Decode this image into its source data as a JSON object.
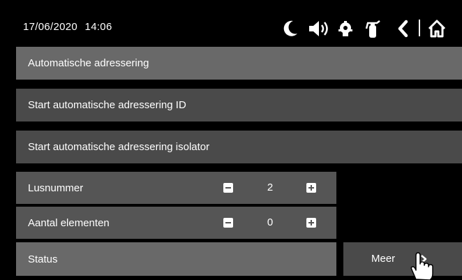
{
  "header": {
    "date": "17/06/2020",
    "time": "14:06",
    "icons": [
      "moon-icon",
      "speaker-icon",
      "firefighter-helmet-icon",
      "fire-extinguisher-icon",
      "back-chevron-icon",
      "home-icon"
    ]
  },
  "menu": {
    "auto_addressing": "Automatische adressering",
    "start_auto_id": "Start automatische adressering ID",
    "start_auto_isolator": "Start automatische adressering isolator"
  },
  "fields": {
    "loop_number": {
      "label": "Lusnummer",
      "value": "2"
    },
    "element_count": {
      "label": "Aantal elementen",
      "value": "0"
    },
    "status": {
      "label": "Status"
    }
  },
  "more_button": {
    "label": "Meer"
  },
  "colors": {
    "background": "#000000",
    "row_light": "#696969",
    "row_dark": "#4a4a4a",
    "row_mid": "#555555",
    "text": "#ffffff"
  }
}
